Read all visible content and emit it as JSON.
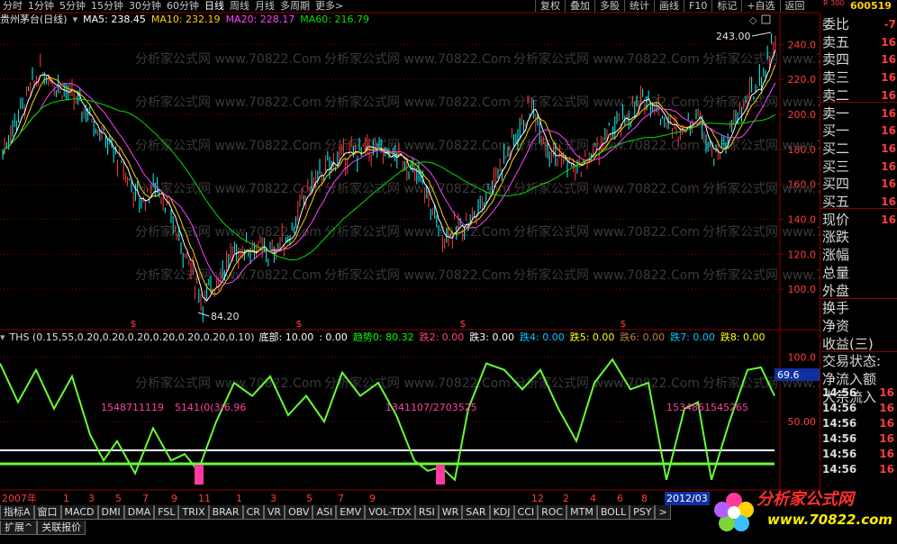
{
  "toolbar": {
    "periods": [
      "分时",
      "1分钟",
      "5分钟",
      "15分钟",
      "30分钟",
      "60分钟",
      "日线",
      "周线",
      "月线",
      "多周期",
      "更多>"
    ],
    "active_period": "日线",
    "functions": [
      "复权",
      "叠加",
      "多股",
      "统计",
      "画线",
      "F10",
      "标记",
      "+自选",
      "返回"
    ],
    "stock_code": "600519",
    "r_icon": "R 300"
  },
  "main_chart": {
    "title": "贵州茅台(日线)",
    "ma": [
      {
        "label": "MA5: 238.45",
        "color": "#ffffff"
      },
      {
        "label": "MA10: 232.19",
        "color": "#ffd200"
      },
      {
        "label": "MA20: 228.17",
        "color": "#ff40ff"
      },
      {
        "label": "MA60: 216.79",
        "color": "#00e000"
      }
    ],
    "y_ticks": [
      "240.0",
      "220.0",
      "200.0",
      "180.0",
      "160.0",
      "140.0",
      "120.0",
      "100.0"
    ],
    "high_label": "243.00",
    "low_label": "84.20",
    "watermark": "分析家公式网 www.70822.Com"
  },
  "indicator": {
    "name": "THS (0.15,55,0.20,0.20,0.20,0.20,0.20,0.20,0.10)",
    "items": [
      {
        "label": "底部: 10.00",
        "color": "#ffffff"
      },
      {
        "label": ": 0.00",
        "color": "#ffffff"
      },
      {
        "label": "趋势0: 80.32",
        "color": "#00ff00"
      },
      {
        "label": "跌2: 0.00",
        "color": "#ff4080"
      },
      {
        "label": "跌3: 0.00",
        "color": "#ffffff"
      },
      {
        "label": "跌4: 0.00",
        "color": "#00c8ff"
      },
      {
        "label": "跌5: 0.00",
        "color": "#ffff00"
      },
      {
        "label": "跌6: 0.00",
        "color": "#c08040"
      },
      {
        "label": "跌7: 0.00",
        "color": "#00c8ff"
      },
      {
        "label": "跌8: 0.00",
        "color": "#ffff00"
      }
    ],
    "y_ticks": [
      "100.0",
      "50.00"
    ],
    "current_value": "69.6",
    "float_labels": [
      "1548711119",
      "5141(0(3)6.96",
      "1341107/2703525",
      "1534861545265"
    ]
  },
  "right_panel": {
    "rows": [
      {
        "label": "委比",
        "value": "-7"
      },
      {
        "label": "卖五",
        "value": "16"
      },
      {
        "label": "卖四",
        "value": "16"
      },
      {
        "label": "卖三",
        "value": "16"
      },
      {
        "label": "卖二",
        "value": "16"
      },
      {
        "label": "卖一",
        "value": "16"
      },
      {
        "label": "买一",
        "value": "16"
      },
      {
        "label": "买二",
        "value": "16"
      },
      {
        "label": "买三",
        "value": "16"
      },
      {
        "label": "买四",
        "value": "16"
      },
      {
        "label": "买五",
        "value": "16"
      },
      {
        "label": "现价",
        "value": "16"
      },
      {
        "label": "涨跌",
        "value": ""
      },
      {
        "label": "涨幅",
        "value": ""
      },
      {
        "label": "总量",
        "value": ""
      },
      {
        "label": "外盘",
        "value": ""
      },
      {
        "label": "换手",
        "value": ""
      },
      {
        "label": "净资",
        "value": ""
      },
      {
        "label": "收益(三)",
        "value": ""
      },
      {
        "label": "交易状态:",
        "value": ""
      },
      {
        "label": "净流入额",
        "value": ""
      },
      {
        "label": "大宗流入",
        "value": ""
      }
    ],
    "ticks": [
      {
        "time": "14:56",
        "price": "16"
      },
      {
        "time": "14:56",
        "price": "16"
      },
      {
        "time": "14:56",
        "price": "16"
      },
      {
        "time": "14:56",
        "price": "16"
      },
      {
        "time": "14:56",
        "price": "16"
      },
      {
        "time": "14:56",
        "price": "16"
      }
    ]
  },
  "date_strip": [
    "2007年",
    "1",
    "3",
    "5",
    "7",
    "9",
    "11",
    "1",
    "3",
    "5",
    "7",
    "9",
    "12",
    "2",
    "4",
    "6",
    "8",
    "2012/03"
  ],
  "indicator_tabs": [
    "指标A",
    "窗口",
    "MACD",
    "DMI",
    "DMA",
    "FSL",
    "TRIX",
    "BRAR",
    "CR",
    "VR",
    "OBV",
    "ASI",
    "EMV",
    "VOL-TDX",
    "RSI",
    "WR",
    "SAR",
    "KDJ",
    "CCI",
    "ROC",
    "MTM",
    "BOLL",
    "PSY",
    ">"
  ],
  "bottom_tabs": [
    "扩展^",
    "关联报价"
  ],
  "logo": {
    "name": "分析家公式网",
    "url": "www.70822.com"
  },
  "colors": {
    "up": "#ff3c3c",
    "down": "#00ffff",
    "grid": "#8b0000",
    "ma60": "#00e000",
    "ths_line": "#66ff33"
  }
}
